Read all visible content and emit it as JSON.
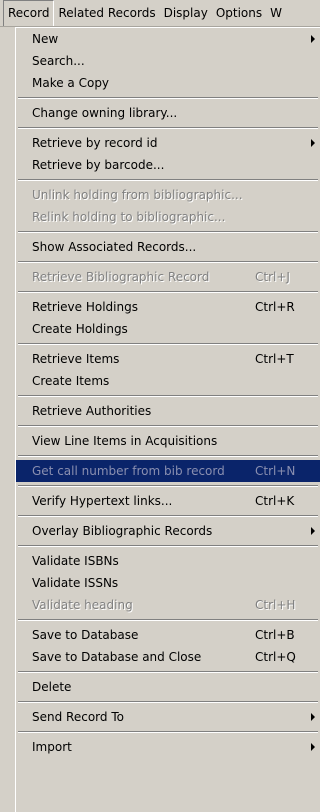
{
  "menubar": {
    "items": [
      "Record",
      "Related Records",
      "Display",
      "Options",
      "W"
    ]
  },
  "menu": {
    "items": [
      {
        "label": "New",
        "submenu": true
      },
      {
        "label": "Search..."
      },
      {
        "label": "Make a Copy"
      },
      {
        "sep": true
      },
      {
        "label": "Change owning library..."
      },
      {
        "sep": true
      },
      {
        "label": "Retrieve by record id",
        "submenu": true
      },
      {
        "label": "Retrieve by barcode..."
      },
      {
        "sep": true
      },
      {
        "label": "Unlink holding from bibliographic...",
        "disabled": true
      },
      {
        "label": "Relink holding to bibliographic...",
        "disabled": true
      },
      {
        "sep": true
      },
      {
        "label": "Show Associated Records..."
      },
      {
        "sep": true
      },
      {
        "label": "Retrieve Bibliographic Record",
        "shortcut": "Ctrl+J",
        "disabled": true
      },
      {
        "sep": true
      },
      {
        "label": "Retrieve Holdings",
        "shortcut": "Ctrl+R"
      },
      {
        "label": "Create Holdings"
      },
      {
        "sep": true
      },
      {
        "label": "Retrieve Items",
        "shortcut": "Ctrl+T"
      },
      {
        "label": "Create Items"
      },
      {
        "sep": true
      },
      {
        "label": "Retrieve Authorities"
      },
      {
        "sep": true
      },
      {
        "label": "View Line Items in Acquisitions"
      },
      {
        "sep": true
      },
      {
        "label": "Get call number from bib record",
        "shortcut": "Ctrl+N",
        "highlight": true
      },
      {
        "sep": true
      },
      {
        "label": "Verify Hypertext links...",
        "shortcut": "Ctrl+K"
      },
      {
        "sep": true
      },
      {
        "label": "Overlay Bibliographic Records",
        "submenu": true
      },
      {
        "sep": true
      },
      {
        "label": "Validate ISBNs"
      },
      {
        "label": "Validate ISSNs"
      },
      {
        "label": "Validate heading",
        "shortcut": "Ctrl+H",
        "disabled": true
      },
      {
        "sep": true
      },
      {
        "label": "Save to Database",
        "shortcut": "Ctrl+B"
      },
      {
        "label": "Save to Database and Close",
        "shortcut": "Ctrl+Q"
      },
      {
        "sep": true
      },
      {
        "label": "Delete"
      },
      {
        "sep": true
      },
      {
        "label": "Send Record To",
        "submenu": true
      },
      {
        "sep": true
      },
      {
        "label": "Import",
        "submenu": true
      }
    ]
  }
}
